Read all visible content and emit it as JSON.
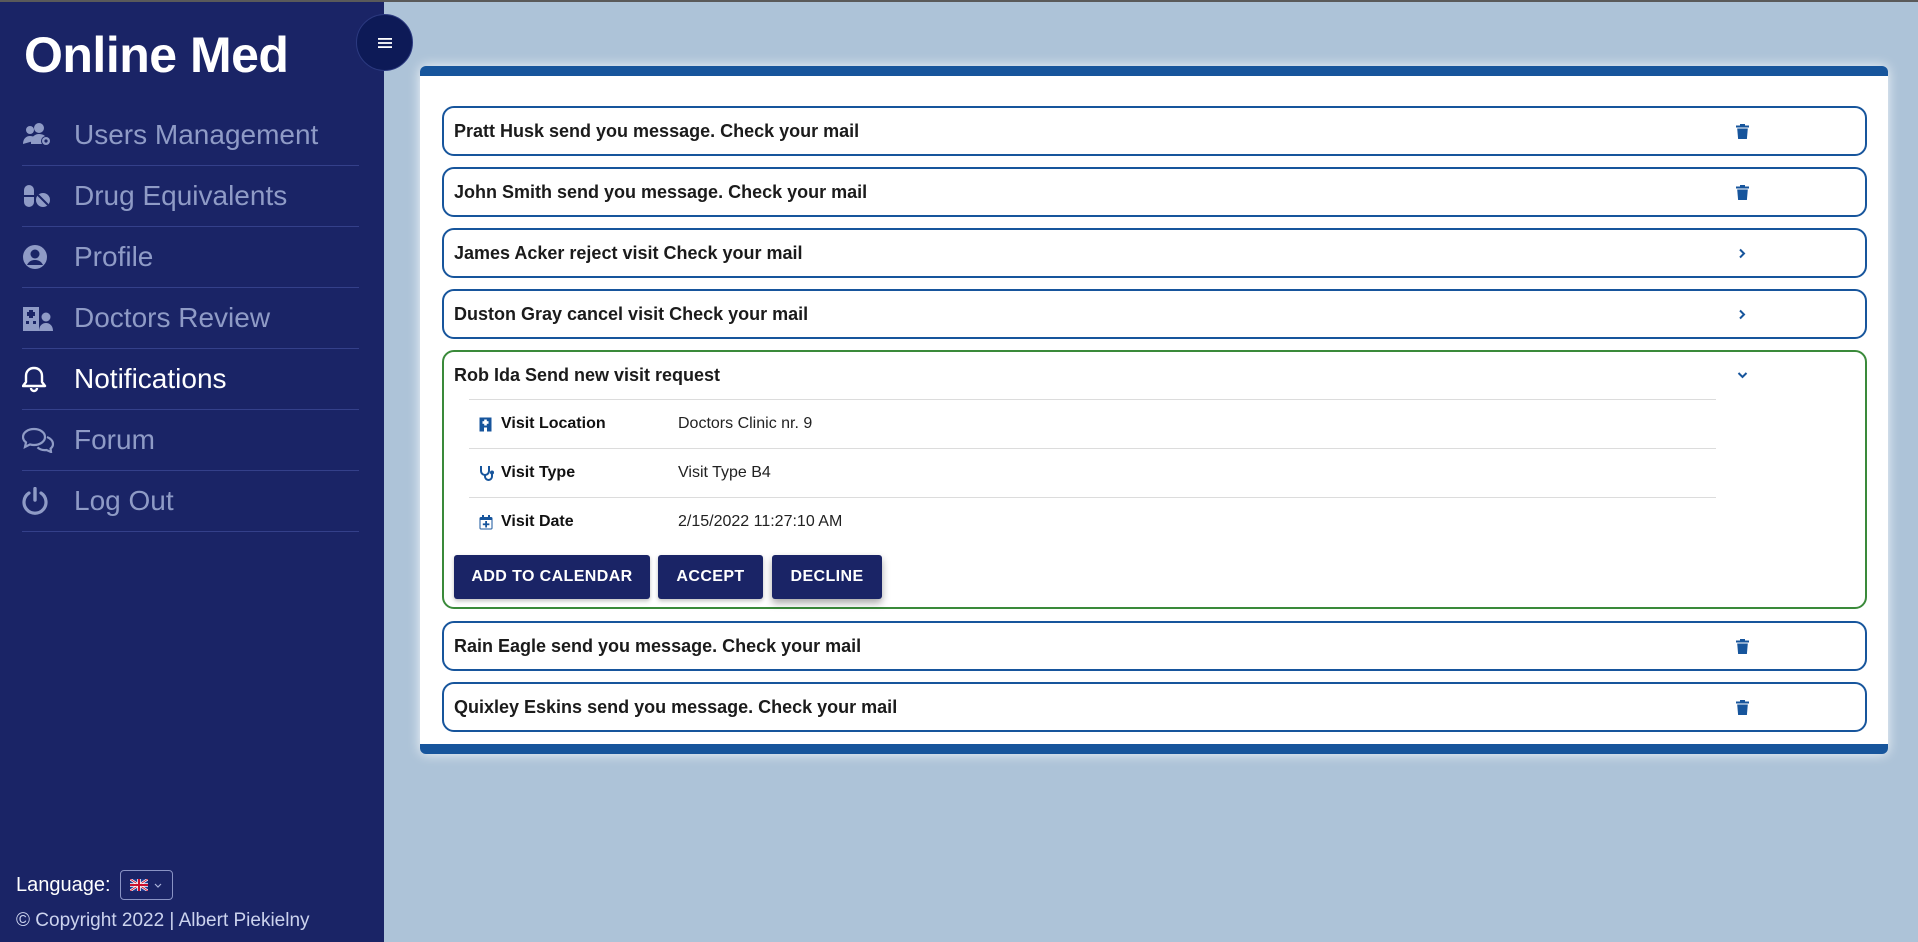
{
  "app": {
    "brand": "Online Med",
    "menu_icon": "hamburger-icon"
  },
  "sidebar": {
    "items": [
      {
        "label": "Users Management",
        "icon": "users-cog-icon",
        "active": false
      },
      {
        "label": "Drug Equivalents",
        "icon": "pills-icon",
        "active": false
      },
      {
        "label": "Profile",
        "icon": "user-circle-icon",
        "active": false
      },
      {
        "label": "Doctors Review",
        "icon": "hospital-user-icon",
        "active": false
      },
      {
        "label": "Notifications",
        "icon": "bell-icon",
        "active": true
      },
      {
        "label": "Forum",
        "icon": "comments-icon",
        "active": false
      },
      {
        "label": "Log Out",
        "icon": "power-icon",
        "active": false
      }
    ],
    "language_label": "Language:",
    "language_value": "🇬🇧",
    "copyright": "© Copyright 2022 | Albert Piekielny"
  },
  "notifications": [
    {
      "text": "Pratt Husk send you message. Check your mail",
      "action": "trash-icon"
    },
    {
      "text": "John Smith send you message. Check your mail",
      "action": "trash-icon"
    },
    {
      "text": "James Acker reject visit Check your mail",
      "action": "chevron-right-icon"
    },
    {
      "text": "Duston Gray cancel visit Check your mail",
      "action": "chevron-right-icon"
    },
    {
      "text": "Rob Ida Send new visit request",
      "action": "chevron-down-icon"
    },
    {
      "text": "Rain Eagle send you message. Check your mail",
      "action": "trash-icon"
    },
    {
      "text": "Quixley Eskins send you message. Check your mail",
      "action": "trash-icon"
    }
  ],
  "visit_request": {
    "details": [
      {
        "label": "Visit Location",
        "value": "Doctors Clinic nr. 9",
        "icon": "hospital-icon"
      },
      {
        "label": "Visit Type",
        "value": "Visit Type B4",
        "icon": "stethoscope-icon"
      },
      {
        "label": "Visit Date",
        "value": "2/15/2022 11:27:10 AM",
        "icon": "calendar-plus-icon"
      }
    ],
    "buttons": {
      "add_to_calendar": "ADD TO CALENDAR",
      "accept": "ACCEPT",
      "decline": "DECLINE"
    }
  },
  "colors": {
    "sidebar_bg": "#1a2466",
    "page_bg": "#adc3d8",
    "accent": "#17559c",
    "expanded_border": "#3a8a3a",
    "button_bg": "#1a2466"
  }
}
